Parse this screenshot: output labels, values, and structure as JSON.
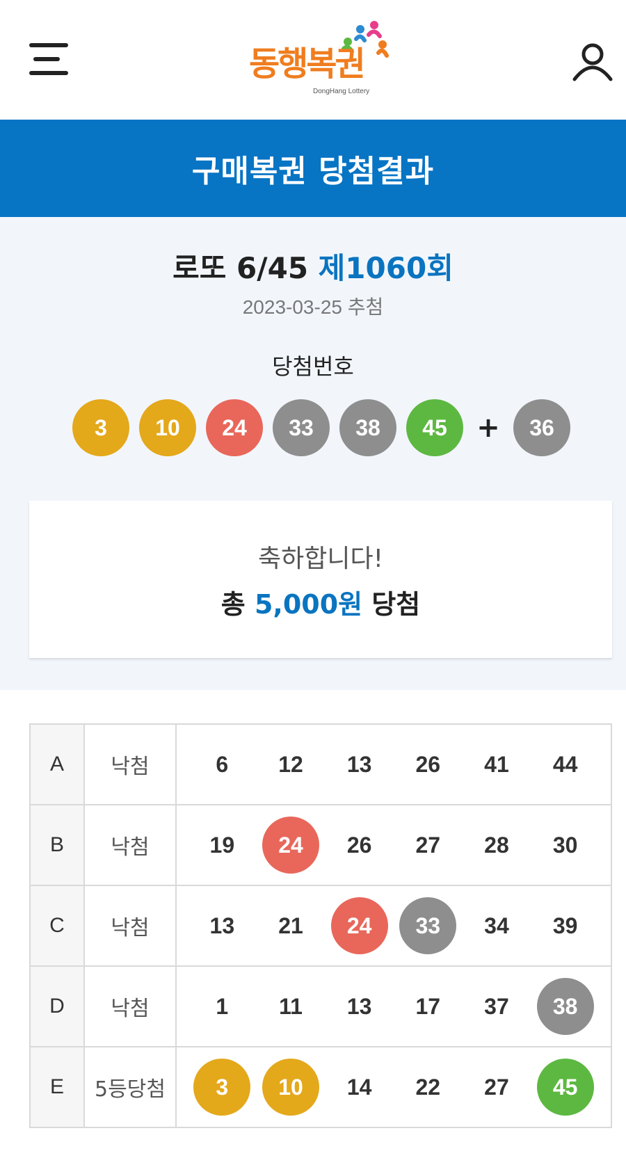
{
  "header": {
    "logo": {
      "text": "동행복권",
      "sub": "DongHang Lottery"
    }
  },
  "banner": {
    "title": "구매복권 당첨결과"
  },
  "draw": {
    "game": "로또 6/45",
    "round": "제1060회",
    "date": "2023-03-25 추첨",
    "winning_label": "당첨번호",
    "numbers": [
      {
        "value": "3",
        "color": "yellow"
      },
      {
        "value": "10",
        "color": "yellow"
      },
      {
        "value": "24",
        "color": "red"
      },
      {
        "value": "33",
        "color": "gray"
      },
      {
        "value": "38",
        "color": "gray"
      },
      {
        "value": "45",
        "color": "green"
      }
    ],
    "plus": "+",
    "bonus": {
      "value": "36",
      "color": "gray"
    }
  },
  "result": {
    "congrats": "축하합니다!",
    "total_prefix": "총",
    "amount": "5,000원",
    "total_suffix": "당첨"
  },
  "tickets": [
    {
      "id": "A",
      "status": "낙첨",
      "numbers": [
        {
          "value": "6",
          "hit": null
        },
        {
          "value": "12",
          "hit": null
        },
        {
          "value": "13",
          "hit": null
        },
        {
          "value": "26",
          "hit": null
        },
        {
          "value": "41",
          "hit": null
        },
        {
          "value": "44",
          "hit": null
        }
      ]
    },
    {
      "id": "B",
      "status": "낙첨",
      "numbers": [
        {
          "value": "19",
          "hit": null
        },
        {
          "value": "24",
          "hit": "red"
        },
        {
          "value": "26",
          "hit": null
        },
        {
          "value": "27",
          "hit": null
        },
        {
          "value": "28",
          "hit": null
        },
        {
          "value": "30",
          "hit": null
        }
      ]
    },
    {
      "id": "C",
      "status": "낙첨",
      "numbers": [
        {
          "value": "13",
          "hit": null
        },
        {
          "value": "21",
          "hit": null
        },
        {
          "value": "24",
          "hit": "red"
        },
        {
          "value": "33",
          "hit": "gray"
        },
        {
          "value": "34",
          "hit": null
        },
        {
          "value": "39",
          "hit": null
        }
      ]
    },
    {
      "id": "D",
      "status": "낙첨",
      "numbers": [
        {
          "value": "1",
          "hit": null
        },
        {
          "value": "11",
          "hit": null
        },
        {
          "value": "13",
          "hit": null
        },
        {
          "value": "17",
          "hit": null
        },
        {
          "value": "37",
          "hit": null
        },
        {
          "value": "38",
          "hit": "gray"
        }
      ]
    },
    {
      "id": "E",
      "status": "5등당첨",
      "numbers": [
        {
          "value": "3",
          "hit": "yellow"
        },
        {
          "value": "10",
          "hit": "yellow"
        },
        {
          "value": "14",
          "hit": null
        },
        {
          "value": "22",
          "hit": null
        },
        {
          "value": "27",
          "hit": null
        },
        {
          "value": "45",
          "hit": "green"
        }
      ]
    }
  ],
  "colors": {
    "brand_blue": "#0874c4",
    "yellow": "#e4a81b",
    "red": "#e8675a",
    "gray": "#8e8e8e",
    "green": "#5db841"
  },
  "icons": {
    "menu": "hamburger-menu-icon",
    "user": "user-icon"
  }
}
